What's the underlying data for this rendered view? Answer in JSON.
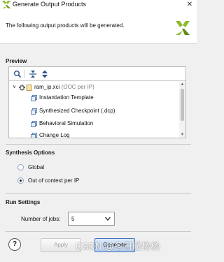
{
  "window": {
    "title": "Generate Output Products",
    "close_glyph": "✕",
    "logo_icon": "xilinx-logo-icon"
  },
  "header": {
    "description": "The following output products will be generated.",
    "logo_icon": "xilinx-logo-icon"
  },
  "preview": {
    "label": "Preview",
    "toolbar": [
      {
        "icon": "search-icon"
      },
      {
        "icon": "collapse-all-icon"
      },
      {
        "icon": "expand-all-icon"
      }
    ],
    "tree": {
      "root": {
        "label": "ram_ip.xci",
        "suffix": "(OOC per IP)",
        "expanded": true,
        "icon": "ip-core-icon"
      },
      "children": [
        {
          "label": "Instantiation Template",
          "icon": "output-product-icon"
        },
        {
          "label": "Synthesized Checkpoint (.dcp)",
          "icon": "output-product-icon"
        },
        {
          "label": "Behavioral Simulation",
          "icon": "output-product-icon"
        },
        {
          "label": "Change Log",
          "icon": "output-product-icon"
        }
      ]
    }
  },
  "synthesis": {
    "label": "Synthesis Options",
    "options": [
      {
        "label": "Global",
        "selected": false
      },
      {
        "label": "Out of context per IP",
        "selected": true
      }
    ]
  },
  "run": {
    "label": "Run Settings",
    "jobs_label": "Number of jobs:",
    "jobs_value": "5"
  },
  "footer": {
    "help": "?",
    "apply_label": "Apply",
    "generate_label": "Generate",
    "watermark": "CSDN @冬日暖杨杨"
  },
  "colors": {
    "accent": "#3f6fb8",
    "logo": "#8dbb2f"
  }
}
